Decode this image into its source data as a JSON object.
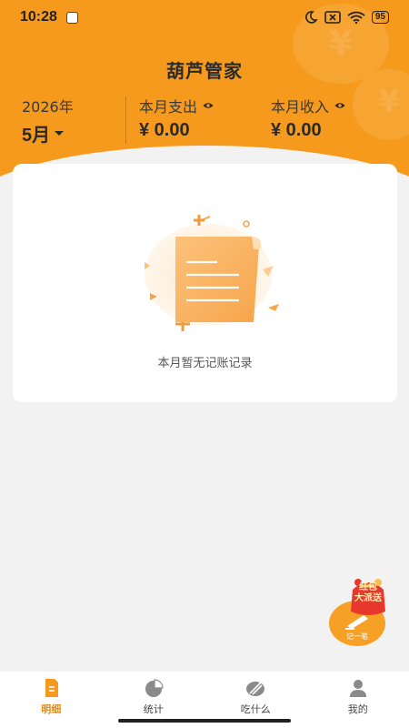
{
  "status_bar": {
    "time": "10:28",
    "battery": "95"
  },
  "app_title": "葫芦管家",
  "summary": {
    "year": "2026年",
    "month": "5月",
    "expense_label": "本月支出",
    "expense_value": "¥ 0.00",
    "income_label": "本月收入",
    "income_value": "¥ 0.00"
  },
  "empty_state": {
    "message": "本月暂无记账记录"
  },
  "fab": {
    "badge_line1": "红包",
    "badge_line2": "大派送",
    "label": "记一笔"
  },
  "tabs": [
    {
      "label": "明细",
      "icon": "detail-icon",
      "active": true
    },
    {
      "label": "统计",
      "icon": "pie-chart-icon",
      "active": false
    },
    {
      "label": "吃什么",
      "icon": "plate-icon",
      "active": false
    },
    {
      "label": "我的",
      "icon": "user-icon",
      "active": false
    }
  ],
  "colors": {
    "accent": "#f59a1c",
    "active_tab": "#e08a10",
    "background": "#f2f2f2"
  }
}
